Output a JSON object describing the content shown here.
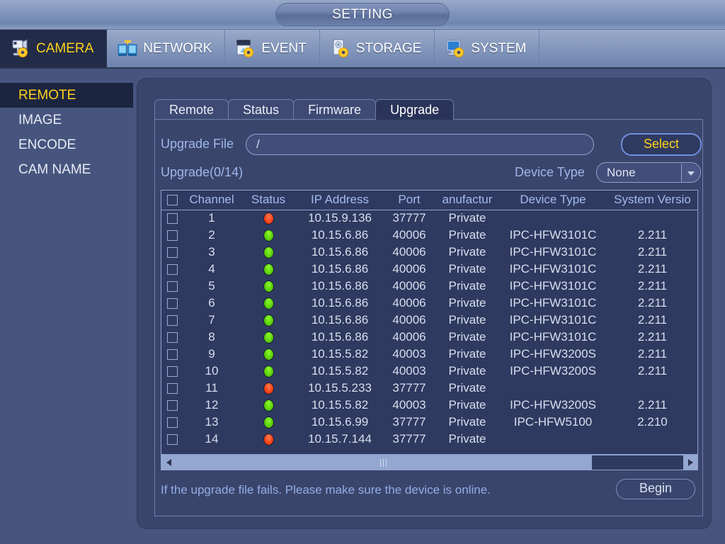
{
  "titlebar": {
    "title": "SETTING"
  },
  "nav": {
    "tabs": [
      {
        "label": "CAMERA",
        "icon": "camera-gear-icon",
        "active": true
      },
      {
        "label": "NETWORK",
        "icon": "network-icon",
        "active": false
      },
      {
        "label": "EVENT",
        "icon": "event-gear-icon",
        "active": false
      },
      {
        "label": "STORAGE",
        "icon": "storage-gear-icon",
        "active": false
      },
      {
        "label": "SYSTEM",
        "icon": "system-gear-icon",
        "active": false
      }
    ]
  },
  "sidebar": {
    "items": [
      {
        "label": "REMOTE",
        "active": true
      },
      {
        "label": "IMAGE",
        "active": false
      },
      {
        "label": "ENCODE",
        "active": false
      },
      {
        "label": "CAM NAME",
        "active": false
      }
    ]
  },
  "subtabs": [
    {
      "label": "Remote",
      "active": false
    },
    {
      "label": "Status",
      "active": false
    },
    {
      "label": "Firmware",
      "active": false
    },
    {
      "label": "Upgrade",
      "active": true
    }
  ],
  "form": {
    "upgrade_file_label": "Upgrade File",
    "upgrade_file_value": "/",
    "upgrade_file_placeholder": "/",
    "select_button": "Select",
    "upgrade_count_label": "Upgrade(0/14)",
    "device_type_label": "Device Type",
    "device_type_value": "None"
  },
  "table": {
    "headers": [
      "",
      "Channel",
      "Status",
      "IP Address",
      "Port",
      "anufactur",
      "Device Type",
      "System Versio"
    ],
    "rows": [
      {
        "checked": false,
        "channel": "1",
        "status": "red",
        "ip": "10.15.9.136",
        "port": "37777",
        "manufacturer": "Private",
        "device_type": "",
        "version": ""
      },
      {
        "checked": false,
        "channel": "2",
        "status": "green",
        "ip": "10.15.6.86",
        "port": "40006",
        "manufacturer": "Private",
        "device_type": "IPC-HFW3101C",
        "version": "2.211"
      },
      {
        "checked": false,
        "channel": "3",
        "status": "green",
        "ip": "10.15.6.86",
        "port": "40006",
        "manufacturer": "Private",
        "device_type": "IPC-HFW3101C",
        "version": "2.211"
      },
      {
        "checked": false,
        "channel": "4",
        "status": "green",
        "ip": "10.15.6.86",
        "port": "40006",
        "manufacturer": "Private",
        "device_type": "IPC-HFW3101C",
        "version": "2.211"
      },
      {
        "checked": false,
        "channel": "5",
        "status": "green",
        "ip": "10.15.6.86",
        "port": "40006",
        "manufacturer": "Private",
        "device_type": "IPC-HFW3101C",
        "version": "2.211"
      },
      {
        "checked": false,
        "channel": "6",
        "status": "green",
        "ip": "10.15.6.86",
        "port": "40006",
        "manufacturer": "Private",
        "device_type": "IPC-HFW3101C",
        "version": "2.211"
      },
      {
        "checked": false,
        "channel": "7",
        "status": "green",
        "ip": "10.15.6.86",
        "port": "40006",
        "manufacturer": "Private",
        "device_type": "IPC-HFW3101C",
        "version": "2.211"
      },
      {
        "checked": false,
        "channel": "8",
        "status": "green",
        "ip": "10.15.6.86",
        "port": "40006",
        "manufacturer": "Private",
        "device_type": "IPC-HFW3101C",
        "version": "2.211"
      },
      {
        "checked": false,
        "channel": "9",
        "status": "green",
        "ip": "10.15.5.82",
        "port": "40003",
        "manufacturer": "Private",
        "device_type": "IPC-HFW3200S",
        "version": "2.211"
      },
      {
        "checked": false,
        "channel": "10",
        "status": "green",
        "ip": "10.15.5.82",
        "port": "40003",
        "manufacturer": "Private",
        "device_type": "IPC-HFW3200S",
        "version": "2.211"
      },
      {
        "checked": false,
        "channel": "11",
        "status": "red",
        "ip": "10.15.5.233",
        "port": "37777",
        "manufacturer": "Private",
        "device_type": "",
        "version": ""
      },
      {
        "checked": false,
        "channel": "12",
        "status": "green",
        "ip": "10.15.5.82",
        "port": "40003",
        "manufacturer": "Private",
        "device_type": "IPC-HFW3200S",
        "version": "2.211"
      },
      {
        "checked": false,
        "channel": "13",
        "status": "green",
        "ip": "10.15.6.99",
        "port": "37777",
        "manufacturer": "Private",
        "device_type": "IPC-HFW5100",
        "version": "2.210"
      },
      {
        "checked": false,
        "channel": "14",
        "status": "red",
        "ip": "10.15.7.144",
        "port": "37777",
        "manufacturer": "Private",
        "device_type": "",
        "version": ""
      }
    ]
  },
  "footer": {
    "note": "If the upgrade file fails. Please make sure the device is online.",
    "begin_button": "Begin"
  },
  "colors": {
    "page_background": "#47557e",
    "panel_background": "#3a456c",
    "table_background": "#2f3a60",
    "accent_yellow": "#ffd11a",
    "label_blue": "#9fb6e8",
    "status_green": "#5fd30c",
    "status_red": "#fb4519"
  }
}
